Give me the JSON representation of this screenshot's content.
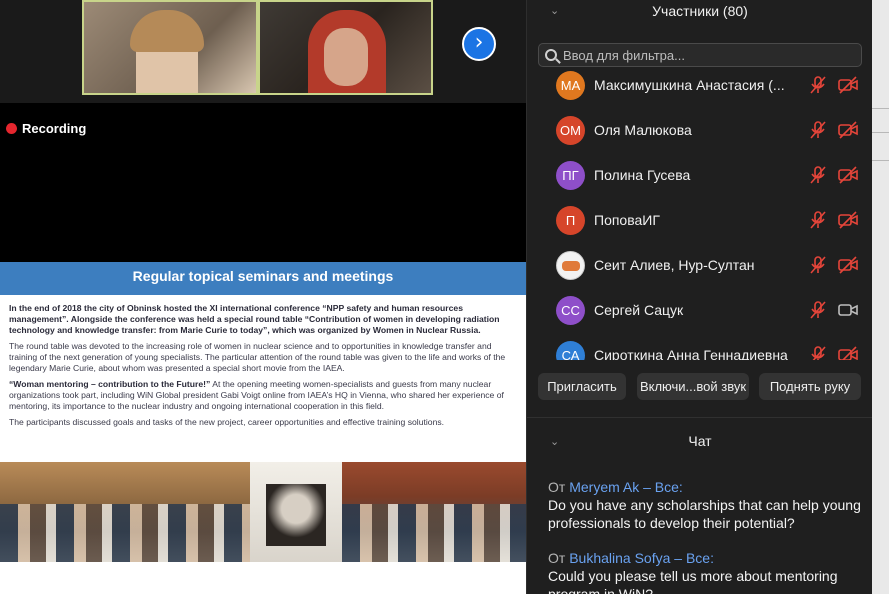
{
  "meeting": {
    "recording_label": "Recording",
    "next_icon": "chevron-right-icon",
    "slide": {
      "title": "Regular topical seminars and meetings",
      "para1": "In the end of 2018 the city of Obninsk hosted the XI international conference “NPP safety and human resources management”. Alongside the conference was held a special round table “Contribution of women in developing radiation technology and knowledge transfer: from Marie Curie to today”, which was organized by Women in Nuclear Russia.",
      "para2": "The round table was devoted to the increasing role of women in nuclear science and to opportunities in knowledge transfer and training of the next generation of young specialists. The particular attention of the round table was given to the life and works of the legendary Marie Curie, about whom was presented a special short movie from the IAEA.",
      "para3_bold": "“Woman mentoring – contribution to the Future!”",
      "para3": " At the opening meeting women-specialists and guests from many nuclear organizations took part, including WiN Global president Gabi Voigt online from IAEA’s HQ in Vienna, who shared her experience of mentoring, its importance to the nuclear industry and ongoing international cooperation in this field.",
      "para4": "The participants discussed goals and tasks of the new project, career opportunities and effective training solutions."
    }
  },
  "participants": {
    "title": "Участники (80)",
    "search_placeholder": "Ввод для фильтра...",
    "items": [
      {
        "initials": "МА",
        "color": "#e0781f",
        "name": "Максимушкина Анастасия (...",
        "mic": "muted",
        "cam": "off"
      },
      {
        "initials": "ОМ",
        "color": "#d6452a",
        "name": "Оля Малюкова",
        "mic": "muted",
        "cam": "off"
      },
      {
        "initials": "ПГ",
        "color": "#8e4fc9",
        "name": "Полина Гусева",
        "mic": "muted",
        "cam": "off"
      },
      {
        "initials": "П",
        "color": "#d6452a",
        "name": "ПоповаИГ",
        "mic": "muted",
        "cam": "off"
      },
      {
        "initials": "",
        "color": "#f2f2f2",
        "name": "Сеит Алиев, Нур-Султан",
        "mic": "muted",
        "cam": "off"
      },
      {
        "initials": "СС",
        "color": "#8e4fc9",
        "name": "Сергей Сацук",
        "mic": "muted",
        "cam": "on"
      },
      {
        "initials": "СА",
        "color": "#2f7fd6",
        "name": "Сироткина Анна Геннадиевна",
        "mic": "muted",
        "cam": "off"
      }
    ],
    "buttons": {
      "invite": "Пригласить",
      "unmute": "Включи...вой звук",
      "raise_hand": "Поднять руку"
    }
  },
  "chat": {
    "title": "Чат",
    "messages": [
      {
        "prefix": "От",
        "sender": "Meryem Ak – Все:",
        "text": "Do you have any scholarships that can help young professionals to develop their potential?"
      },
      {
        "prefix": "От",
        "sender": "Bukhalina Sofya – Все:",
        "text": "Could you please tell us more about mentoring program in WiN?"
      }
    ]
  },
  "colors": {
    "accent": "#1b74e4",
    "muted_icon": "#e5453a",
    "slide_header": "#3d7ebf",
    "sender_link": "#6aa2f0"
  }
}
